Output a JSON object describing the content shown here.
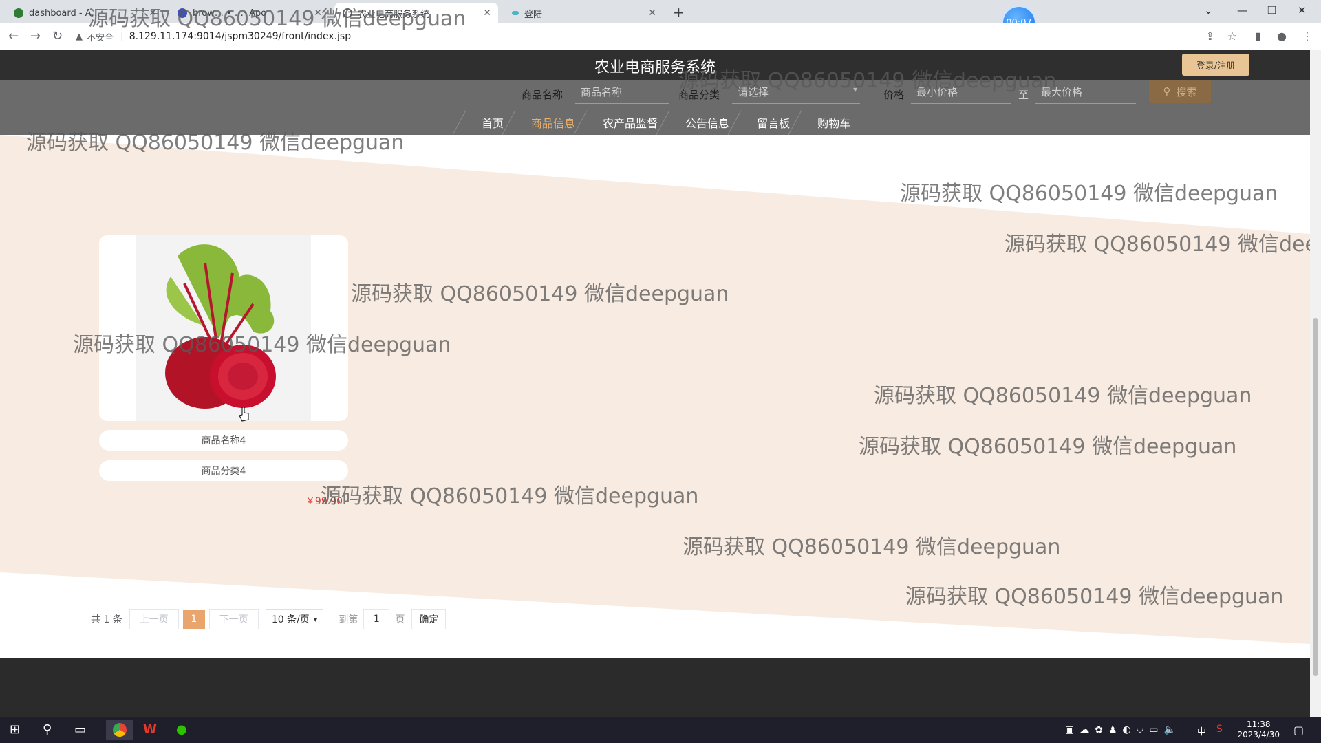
{
  "browser": {
    "tabs": [
      {
        "title": "dashboard - A…",
        "favicon_color": "#2e7d32"
      },
      {
        "title": "brow… • …· Apo",
        "favicon_color": "#3f51b5"
      },
      {
        "title": "农业电商服务系统",
        "favicon_color": "#5f6368"
      },
      {
        "title": "登陆",
        "favicon_color": "#4fb3c7"
      }
    ],
    "new_tab": "+",
    "timer": "00:07",
    "insecure_label": "不安全",
    "url": "8.129.11.174:9014/jspm30249/front/index.jsp"
  },
  "site": {
    "title": "农业电商服务系统",
    "login_button": "登录/注册",
    "search": {
      "name_label": "商品名称",
      "name_placeholder": "商品名称",
      "category_label": "商品分类",
      "category_placeholder": "请选择",
      "price_label": "价格",
      "min_price_placeholder": "最小价格",
      "to_label": "至",
      "max_price_placeholder": "最大价格",
      "button": "搜索"
    },
    "menu": [
      {
        "label": "首页",
        "active": false
      },
      {
        "label": "商品信息",
        "active": true
      },
      {
        "label": "农产品监督",
        "active": false
      },
      {
        "label": "公告信息",
        "active": false
      },
      {
        "label": "留言板",
        "active": false
      },
      {
        "label": "购物车",
        "active": false
      }
    ],
    "accent_color": "#e9c494"
  },
  "products": [
    {
      "name": "商品名称4",
      "category": "商品分类4",
      "price": "￥99.90"
    }
  ],
  "pagination": {
    "total": "共 1 条",
    "prev": "上一页",
    "current_page": "1",
    "next": "下一页",
    "page_size": "10 条/页",
    "goto_label": "到第",
    "goto_value": "1",
    "page_label": "页",
    "confirm": "确定"
  },
  "watermark": "源码获取 QQ86050149 微信deepguan",
  "taskbar": {
    "time": "11:38",
    "date": "2023/4/30",
    "ime": "中"
  }
}
